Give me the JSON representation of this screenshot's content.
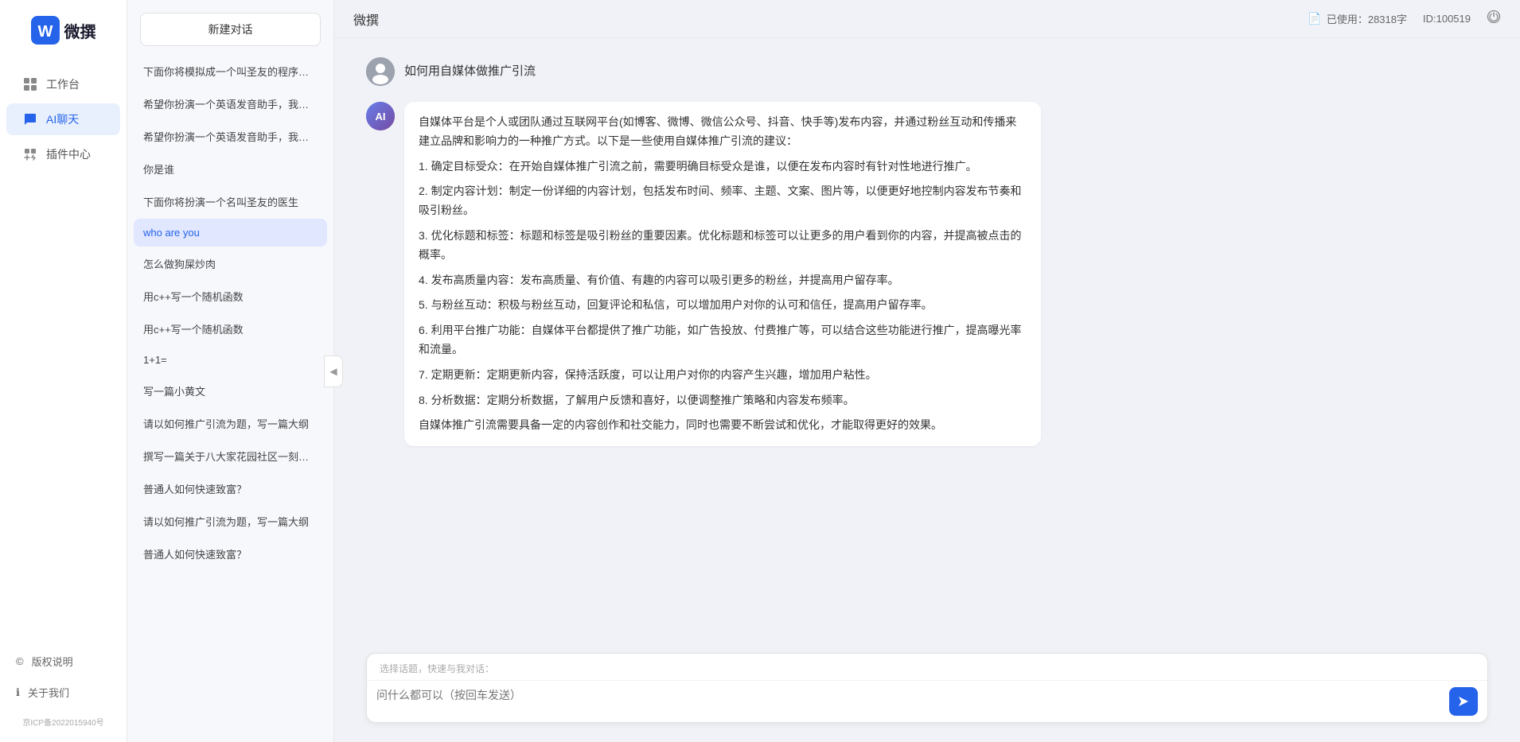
{
  "app": {
    "name": "微撰",
    "logo_letter": "W"
  },
  "header": {
    "title": "微撰",
    "usage_icon": "📋",
    "usage_label": "已使用：28318字",
    "user_id": "ID:100519",
    "logout_icon": "⏻"
  },
  "sidebar": {
    "nav_items": [
      {
        "id": "workbench",
        "icon": "🖥",
        "label": "工作台"
      },
      {
        "id": "ai-chat",
        "icon": "💬",
        "label": "AI聊天",
        "active": true
      },
      {
        "id": "plugin",
        "icon": "📦",
        "label": "插件中心"
      }
    ],
    "bottom_items": [
      {
        "id": "copyright",
        "icon": "©",
        "label": "版权说明"
      },
      {
        "id": "about",
        "icon": "ℹ",
        "label": "关于我们"
      }
    ],
    "icp": "京ICP备2022015940号"
  },
  "history": {
    "new_chat_label": "新建对话",
    "items": [
      {
        "id": 1,
        "text": "下面你将模拟成一个叫圣友的程序员，我说..."
      },
      {
        "id": 2,
        "text": "希望你扮演一个英语发音助手，我提供给你..."
      },
      {
        "id": 3,
        "text": "希望你扮演一个英语发音助手，我提供给你..."
      },
      {
        "id": 4,
        "text": "你是谁"
      },
      {
        "id": 5,
        "text": "下面你将扮演一个名叫圣友的医生"
      },
      {
        "id": 6,
        "text": "who are you",
        "active": true
      },
      {
        "id": 7,
        "text": "怎么做狗屎炒肉"
      },
      {
        "id": 8,
        "text": "用c++写一个随机函数"
      },
      {
        "id": 9,
        "text": "用c++写一个随机函数"
      },
      {
        "id": 10,
        "text": "1+1="
      },
      {
        "id": 11,
        "text": "写一篇小黄文"
      },
      {
        "id": 12,
        "text": "请以如何推广引流为题，写一篇大纲"
      },
      {
        "id": 13,
        "text": "撰写一篇关于八大家花园社区一刻钟便民生..."
      },
      {
        "id": 14,
        "text": "普通人如何快速致富？"
      },
      {
        "id": 15,
        "text": "请以如何推广引流为题，写一篇大纲"
      },
      {
        "id": 16,
        "text": "普通人如何快速致富？"
      }
    ]
  },
  "chat": {
    "messages": [
      {
        "id": 1,
        "role": "user",
        "text": "如何用自媒体做推广引流"
      },
      {
        "id": 2,
        "role": "assistant",
        "paragraphs": [
          "自媒体平台是个人或团队通过互联网平台(如博客、微博、微信公众号、抖音、快手等)发布内容，并通过粉丝互动和传播来建立品牌和影响力的一种推广方式。以下是一些使用自媒体推广引流的建议：",
          "1. 确定目标受众：在开始自媒体推广引流之前，需要明确目标受众是谁，以便在发布内容时有针对性地进行推广。",
          "2. 制定内容计划：制定一份详细的内容计划，包括发布时间、频率、主题、文案、图片等，以便更好地控制内容发布节奏和吸引粉丝。",
          "3. 优化标题和标签：标题和标签是吸引粉丝的重要因素。优化标题和标签可以让更多的用户看到你的内容，并提高被点击的概率。",
          "4. 发布高质量内容：发布高质量、有价值、有趣的内容可以吸引更多的粉丝，并提高用户留存率。",
          "5. 与粉丝互动：积极与粉丝互动，回复评论和私信，可以增加用户对你的认可和信任，提高用户留存率。",
          "6. 利用平台推广功能：自媒体平台都提供了推广功能，如广告投放、付费推广等，可以结合这些功能进行推广，提高曝光率和流量。",
          "7. 定期更新：定期更新内容，保持活跃度，可以让用户对你的内容产生兴趣，增加用户粘性。",
          "8. 分析数据：定期分析数据，了解用户反馈和喜好，以便调整推广策略和内容发布频率。",
          "自媒体推广引流需要具备一定的内容创作和社交能力，同时也需要不断尝试和优化，才能取得更好的效果。"
        ]
      }
    ],
    "input": {
      "quick_topics_label": "选择话题，快速与我对话：",
      "placeholder": "问什么都可以（按回车发送）"
    }
  },
  "icons": {
    "send": "➤",
    "collapse": "◀",
    "usage_doc": "📄"
  }
}
